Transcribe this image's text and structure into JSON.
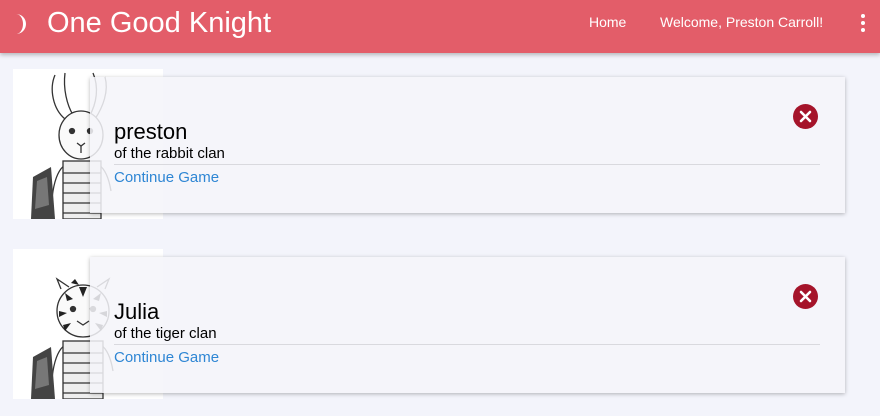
{
  "header": {
    "title": "One Good Knight",
    "home_label": "Home",
    "welcome_text": "Welcome, Preston Carroll!",
    "background_color": "#e35d69",
    "theme_icon": "moon-icon",
    "menu_icon": "more-vertical-icon"
  },
  "games": [
    {
      "name": "preston",
      "clan": "of the rabbit clan",
      "continue_label": "Continue Game",
      "portrait_icon": "rabbit-knight-portrait",
      "delete_icon": "close-circle-icon"
    },
    {
      "name": "Julia",
      "clan": "of the tiger clan",
      "continue_label": "Continue Game",
      "portrait_icon": "tiger-knight-portrait",
      "delete_icon": "close-circle-icon"
    }
  ],
  "colors": {
    "link": "#2e86d4",
    "delete": "#a5142a",
    "page_background": "#f3f4fb"
  }
}
